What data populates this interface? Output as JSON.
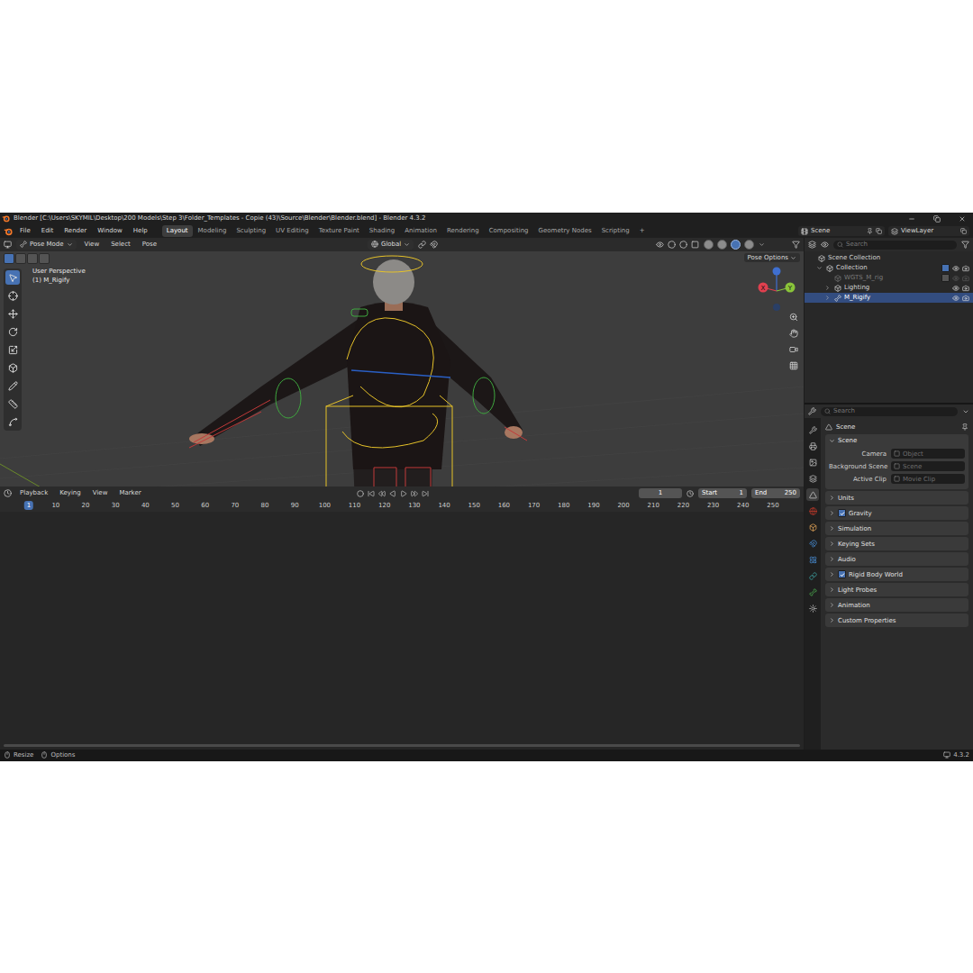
{
  "window": {
    "title": "Blender [C:\\Users\\SKYMIL\\Desktop\\200 Models\\Step 3\\Folder_Templates - Copie (43)\\Source\\Blender\\Blender.blend] - Blender 4.3.2"
  },
  "menus": [
    "File",
    "Edit",
    "Render",
    "Window",
    "Help"
  ],
  "workspaces": [
    {
      "label": "Layout",
      "selected": true
    },
    {
      "label": "Modeling",
      "selected": false
    },
    {
      "label": "Sculpting",
      "selected": false
    },
    {
      "label": "UV Editing",
      "selected": false
    },
    {
      "label": "Texture Paint",
      "selected": false
    },
    {
      "label": "Shading",
      "selected": false
    },
    {
      "label": "Animation",
      "selected": false
    },
    {
      "label": "Rendering",
      "selected": false
    },
    {
      "label": "Compositing",
      "selected": false
    },
    {
      "label": "Geometry Nodes",
      "selected": false
    },
    {
      "label": "Scripting",
      "selected": false
    }
  ],
  "add_workspace": "+",
  "scene": "Scene",
  "view_layer": "ViewLayer",
  "viewport": {
    "mode": "Pose Mode",
    "menus": [
      "View",
      "Select",
      "Pose"
    ],
    "orientation": "Global",
    "info": [
      "User Perspective",
      "(1) M_Rigify"
    ],
    "pose_options": "Pose Options",
    "tools": [
      {
        "selected": true
      },
      {
        "selected": false
      },
      {
        "selected": false
      },
      {
        "selected": false
      },
      {
        "selected": false
      },
      {
        "selected": false
      },
      {
        "selected": false
      },
      {
        "selected": false
      },
      {
        "selected": false
      }
    ],
    "shading": [
      {
        "selected": false
      },
      {
        "selected": false
      },
      {
        "selected": true
      },
      {
        "selected": false
      }
    ],
    "gizmo": [
      {
        "label": "X",
        "color": "#e0404f"
      },
      {
        "label": "Y",
        "color": "#8ac43a"
      }
    ]
  },
  "outliner": {
    "search": "Search",
    "tree": [
      {
        "label": "Scene Collection",
        "kind": "root",
        "selected": false,
        "children": [
          {
            "label": "Collection",
            "kind": "collection",
            "expanded": true,
            "selected": false,
            "included": true,
            "visible": true,
            "renderable": true,
            "children": [
              {
                "label": "WGTS_M_rig",
                "kind": "collection",
                "selected": false,
                "included": false,
                "visible": false,
                "renderable": false,
                "children": []
              },
              {
                "label": "Lighting",
                "kind": "collection",
                "expanded": false,
                "selected": false,
                "visible": true,
                "renderable": true,
                "children": []
              },
              {
                "label": "M_Rigify",
                "kind": "armature",
                "expanded": false,
                "selected": true,
                "visible": true,
                "renderable": true,
                "children": []
              }
            ]
          }
        ]
      }
    ]
  },
  "properties": {
    "search": "Search",
    "context": "Scene",
    "tabs": [
      {
        "selected": false
      },
      {
        "selected": false
      },
      {
        "selected": false
      },
      {
        "selected": false
      },
      {
        "selected": true
      },
      {
        "selected": false
      },
      {
        "selected": false
      },
      {
        "selected": false
      },
      {
        "selected": false
      },
      {
        "selected": false
      },
      {
        "selected": false
      },
      {
        "selected": false
      }
    ],
    "panel": {
      "title": "Scene",
      "expanded": true,
      "fields": [
        {
          "label": "Camera",
          "value": "Object"
        },
        {
          "label": "Background Scene",
          "value": "Scene"
        },
        {
          "label": "Active Clip",
          "value": "Movie Clip"
        }
      ]
    },
    "sections": [
      {
        "label": "Units",
        "kind": "plain",
        "expanded": false
      },
      {
        "label": "Gravity",
        "kind": "toggle",
        "checked": true,
        "expanded": false
      },
      {
        "label": "Simulation",
        "kind": "plain",
        "expanded": false
      },
      {
        "label": "Keying Sets",
        "kind": "plain",
        "expanded": false
      },
      {
        "label": "Audio",
        "kind": "plain",
        "expanded": false
      },
      {
        "label": "Rigid Body World",
        "kind": "toggle",
        "checked": true,
        "expanded": false
      },
      {
        "label": "Light Probes",
        "kind": "plain",
        "expanded": false
      },
      {
        "label": "Animation",
        "kind": "plain",
        "expanded": false
      },
      {
        "label": "Custom Properties",
        "kind": "plain",
        "expanded": false
      }
    ]
  },
  "timeline": {
    "menus": [
      "Playback",
      "Keying",
      "View",
      "Marker"
    ],
    "current_frame": "1",
    "start_label": "Start",
    "start": "1",
    "end_label": "End",
    "end": "250",
    "playhead": "1",
    "ticks": [
      "10",
      "20",
      "30",
      "40",
      "50",
      "60",
      "70",
      "80",
      "90",
      "100",
      "110",
      "120",
      "130",
      "140",
      "150",
      "160",
      "170",
      "180",
      "190",
      "200",
      "210",
      "220",
      "230",
      "240",
      "250"
    ]
  },
  "status_bar": {
    "items": [
      "Resize",
      "Options"
    ],
    "version": "4.3.2"
  }
}
